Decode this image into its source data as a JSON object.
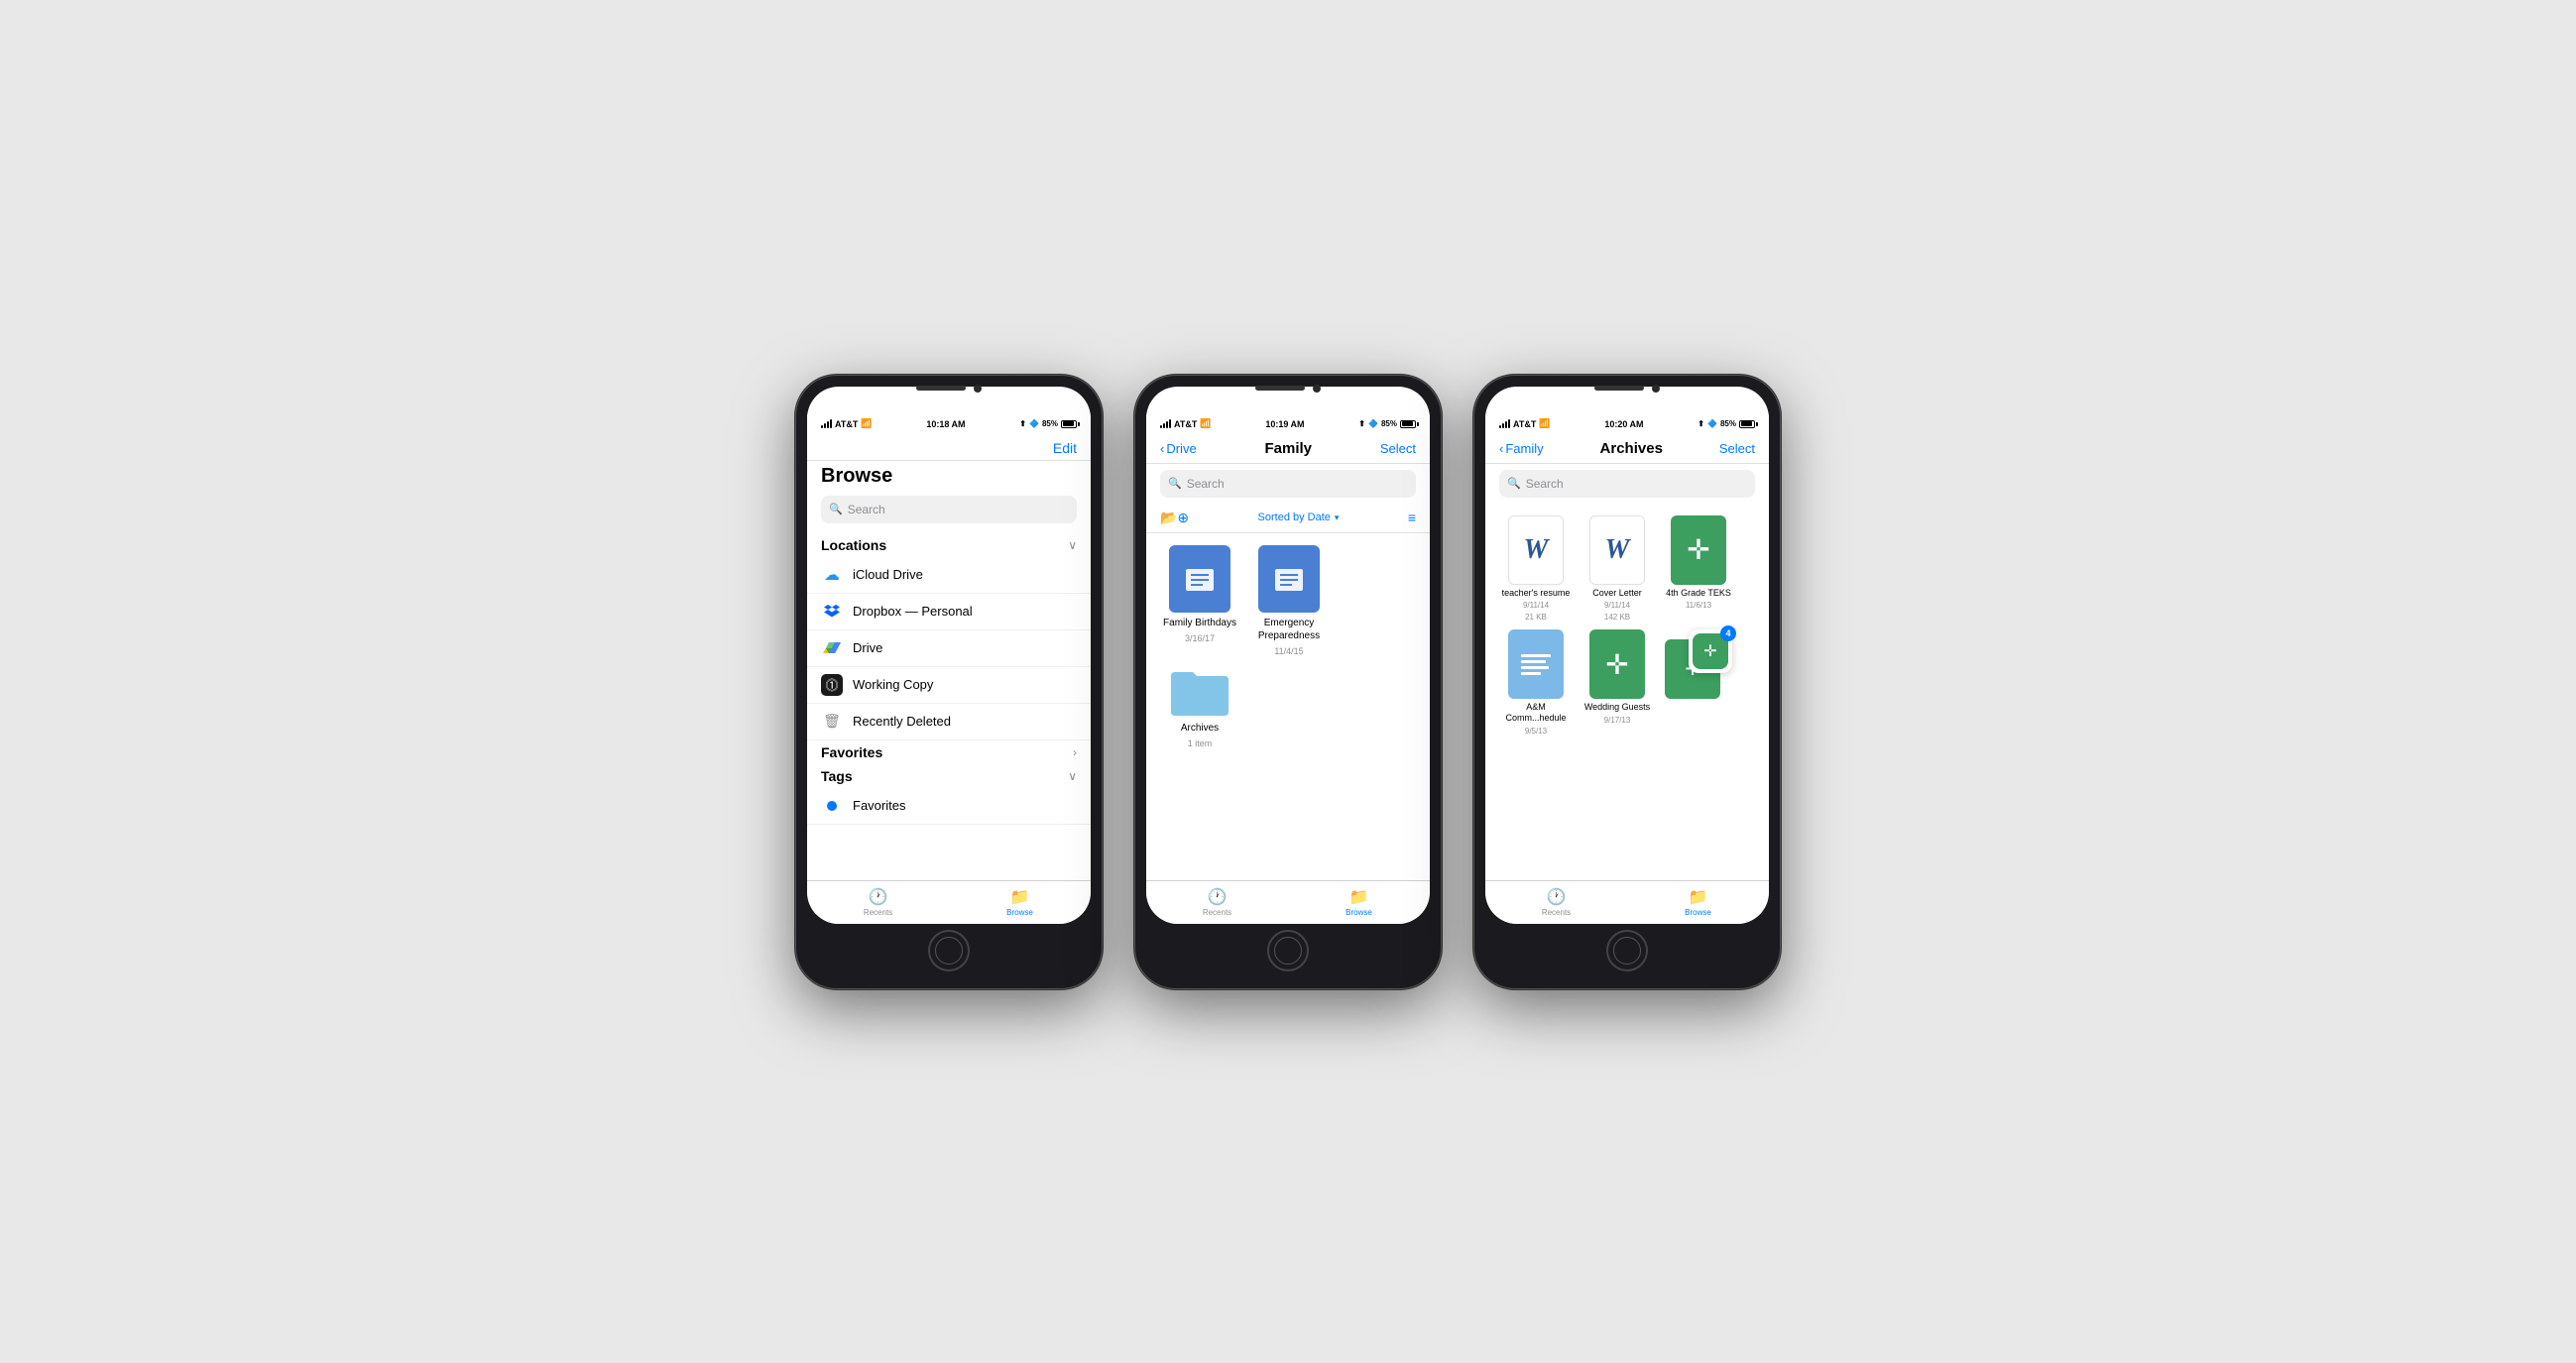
{
  "phones": [
    {
      "id": "browse",
      "statusBar": {
        "carrier": "AT&T",
        "wifi": true,
        "time": "10:18 AM",
        "battery": "85%"
      },
      "nav": {
        "title": "Browse",
        "editBtn": "Edit"
      },
      "search": {
        "placeholder": "Search"
      },
      "sections": {
        "locations": {
          "title": "Locations",
          "items": [
            {
              "label": "iCloud Drive",
              "icon": "icloud"
            },
            {
              "label": "Dropbox — Personal",
              "icon": "dropbox"
            },
            {
              "label": "Drive",
              "icon": "drive"
            },
            {
              "label": "Working Copy",
              "icon": "working-copy"
            },
            {
              "label": "Recently Deleted",
              "icon": "trash"
            }
          ]
        },
        "favorites": {
          "title": "Favorites",
          "hasArrow": true
        },
        "tags": {
          "title": "Tags",
          "items": [
            {
              "label": "Favorites",
              "icon": "dot-blue"
            }
          ]
        }
      },
      "tabBar": {
        "tabs": [
          {
            "label": "Recents",
            "icon": "clock",
            "active": false
          },
          {
            "label": "Browse",
            "icon": "folder",
            "active": true
          }
        ]
      }
    },
    {
      "id": "family",
      "statusBar": {
        "carrier": "AT&T",
        "wifi": true,
        "time": "10:19 AM",
        "battery": "85%"
      },
      "nav": {
        "backLabel": "Drive",
        "title": "Family",
        "actionBtn": "Select"
      },
      "search": {
        "placeholder": "Search"
      },
      "toolbar": {
        "sortLabel": "Sorted by Date",
        "addFolder": true,
        "listView": true
      },
      "items": [
        {
          "name": "Family Birthdays",
          "date": "3/16/17",
          "type": "doc"
        },
        {
          "name": "Emergency Preparedness",
          "date": "11/4/15",
          "type": "doc"
        },
        {
          "name": "Archives",
          "subtitle": "1 item",
          "type": "folder"
        }
      ],
      "tabBar": {
        "tabs": [
          {
            "label": "Recents",
            "icon": "clock",
            "active": false
          },
          {
            "label": "Browse",
            "icon": "folder",
            "active": true
          }
        ]
      }
    },
    {
      "id": "archives",
      "statusBar": {
        "carrier": "AT&T",
        "wifi": true,
        "time": "10:20 AM",
        "battery": "85%"
      },
      "nav": {
        "backLabel": "Family",
        "title": "Archives",
        "actionBtn": "Select"
      },
      "search": {
        "placeholder": "Search"
      },
      "items": [
        {
          "name": "teacher's resume",
          "date": "9/11/14",
          "size": "21 KB",
          "type": "word"
        },
        {
          "name": "Cover Letter",
          "date": "9/11/14",
          "size": "142 KB",
          "type": "word"
        },
        {
          "name": "4th Grade TEKS",
          "date": "11/6/13",
          "type": "cross"
        },
        {
          "name": "A&M Comm...hedule",
          "date": "9/5/13",
          "type": "pages"
        },
        {
          "name": "Wedding Guests",
          "date": "9/17/13",
          "type": "cross"
        },
        {
          "name": "",
          "date": "",
          "type": "popup",
          "badge": "4"
        }
      ],
      "tabBar": {
        "tabs": [
          {
            "label": "Recents",
            "icon": "clock",
            "active": false
          },
          {
            "label": "Browse",
            "icon": "folder",
            "active": true
          }
        ]
      }
    }
  ]
}
